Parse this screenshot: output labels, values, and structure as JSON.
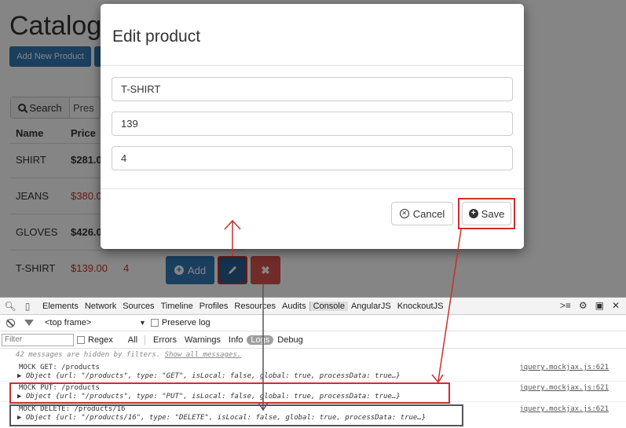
{
  "page": {
    "title": "Catalog",
    "add_new_label": "Add New Product",
    "search_label": "Search",
    "search_stub": "Pres",
    "columns": {
      "name": "Name",
      "price": "Price"
    },
    "rows": [
      {
        "name": "SHIRT",
        "price": "$281.0"
      },
      {
        "name": "JEANS",
        "price": "$380.0"
      },
      {
        "name": "GLOVES",
        "price": "$426.0"
      },
      {
        "name": "T-SHIRT",
        "price": "$139.00",
        "qty": "4"
      }
    ],
    "row_actions": {
      "add_label": "Add",
      "delete_glyph": "✖"
    }
  },
  "modal": {
    "title": "Edit product",
    "fields": {
      "name": "T-SHIRT",
      "price": "139",
      "stock": "4"
    },
    "cancel_label": "Cancel",
    "save_label": "Save"
  },
  "devtools": {
    "tabs": [
      "Elements",
      "Network",
      "Sources",
      "Timeline",
      "Profiles",
      "Resources",
      "Audits",
      "Console",
      "AngularJS",
      "KnockoutJS"
    ],
    "active_tab": "Console",
    "frame_select": "<top frame>",
    "preserve_log_label": "Preserve log",
    "filter_placeholder": "Filter",
    "regex_label": "Regex",
    "levels": [
      "All",
      "Errors",
      "Warnings",
      "Info",
      "Logs",
      "Debug"
    ],
    "active_level": "Logs",
    "hidden_message_prefix": "42 messages are hidden by filters.",
    "hidden_message_link": "Show all messages.",
    "log_entries": [
      {
        "message": "MOCK GET: /products",
        "object": "Object {url: \"/products\", type: \"GET\", isLocal: false, global: true, processData: true…}",
        "source": "jquery.mockjax.js:621"
      },
      {
        "message": "MOCK PUT: /products",
        "object": "Object {url: \"/products\", type: \"PUT\", isLocal: false, global: true, processData: true…}",
        "source": "jquery.mockjax.js:621"
      },
      {
        "message": "MOCK DELETE: /products/16",
        "object": "Object {url: \"/products/16\", type: \"DELETE\", isLocal: false, global: true, processData: true…}",
        "source": "jquery.mockjax.js:621"
      }
    ]
  },
  "colors": {
    "primary": "#337ab7",
    "danger": "#d9534f",
    "highlight_red": "#c9302c",
    "highlight_gray": "#555555"
  }
}
